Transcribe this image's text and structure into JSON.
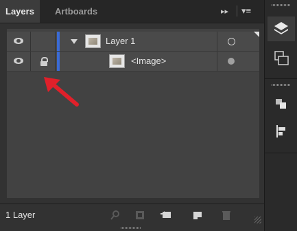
{
  "tabs": [
    {
      "label": "Layers",
      "active": true
    },
    {
      "label": "Artboards",
      "active": false
    }
  ],
  "layers": [
    {
      "name": "Layer 1",
      "visible": true,
      "locked": false,
      "expanded": true,
      "indent": 0
    },
    {
      "name": "<Image>",
      "visible": true,
      "locked": true,
      "indent": 1
    }
  ],
  "footer": {
    "layer_count": "1 Layer"
  },
  "colors": {
    "layer_color": "#3a6bd6",
    "annotation_arrow": "#e0202a"
  },
  "icons": {
    "panel_menu": "double-chevron-right-icon",
    "hamburger": "hamburger-menu-icon",
    "footer": [
      "locate-object-icon",
      "make-clipping-mask-icon",
      "create-sublayer-icon",
      "create-layer-icon",
      "delete-icon"
    ],
    "dock": [
      "layers-icon",
      "artboards-icon",
      "arrange-icon",
      "align-icon"
    ]
  }
}
